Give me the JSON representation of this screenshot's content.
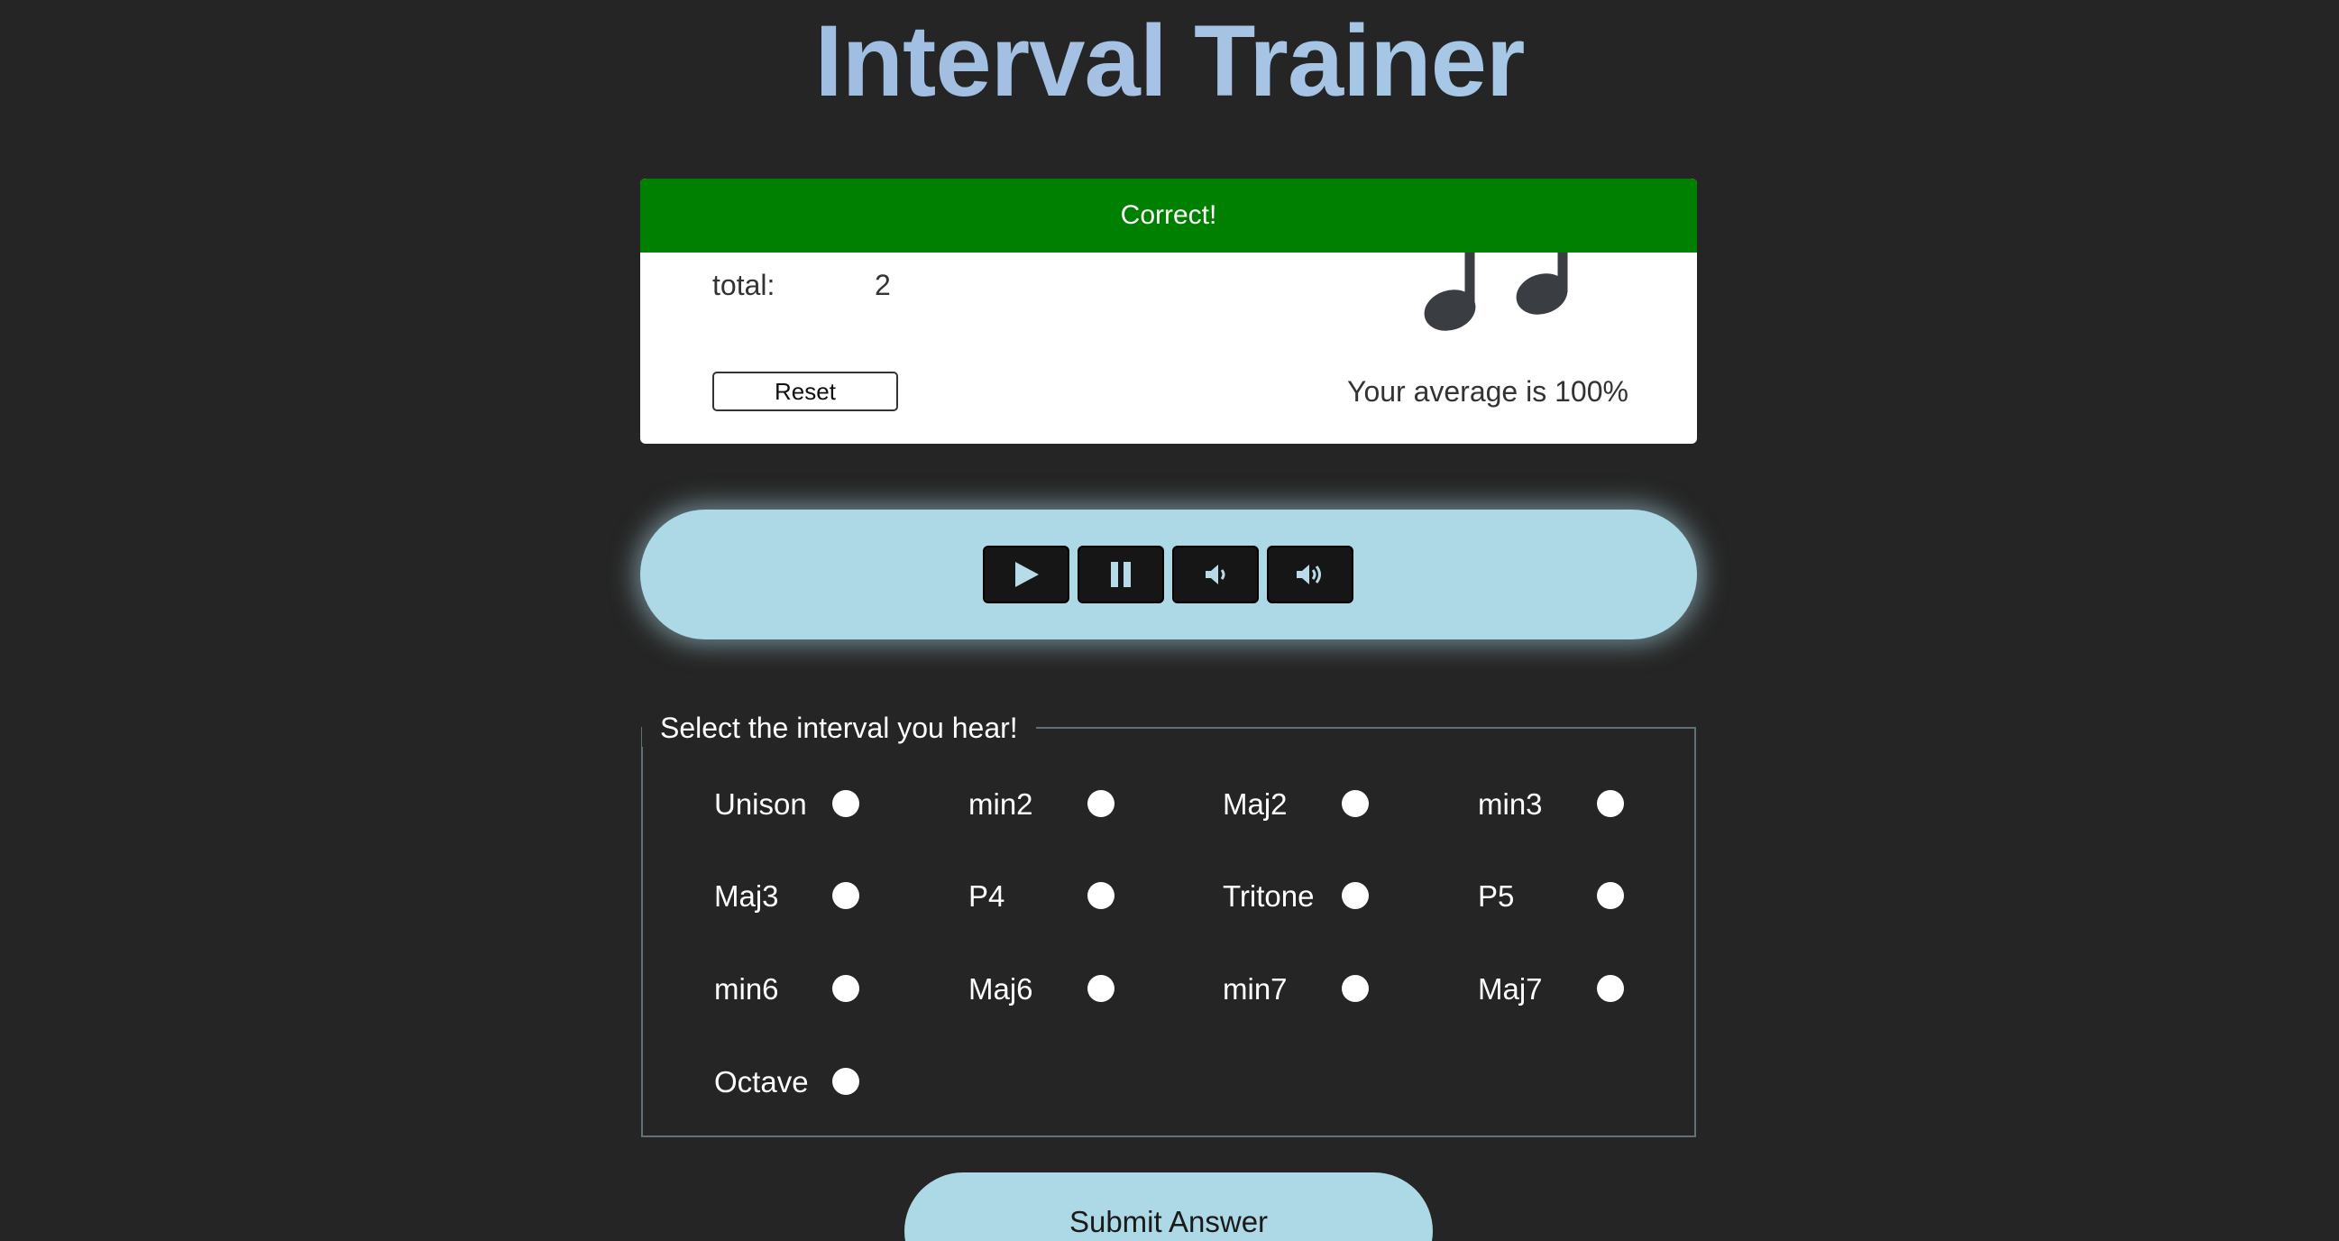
{
  "app": {
    "title": "Interval Trainer"
  },
  "score": {
    "feedback": "Correct!",
    "total_label": "total:",
    "total_value": "2",
    "reset_label": "Reset",
    "average_text": "Your average is 100%"
  },
  "player": {
    "buttons": [
      {
        "name": "play",
        "icon": "play-icon"
      },
      {
        "name": "pause",
        "icon": "pause-icon"
      },
      {
        "name": "volume-down",
        "icon": "volume-low-icon"
      },
      {
        "name": "volume-up",
        "icon": "volume-high-icon"
      }
    ]
  },
  "intervals": {
    "legend": "Select the interval you hear!",
    "options": [
      "Unison",
      "min2",
      "Maj2",
      "min3",
      "Maj3",
      "P4",
      "Tritone",
      "P5",
      "min6",
      "Maj6",
      "min7",
      "Maj7",
      "Octave"
    ]
  },
  "submit_label": "Submit Answer",
  "colors": {
    "background": "#252525",
    "accent": "#add8e6",
    "success": "#008000",
    "title_gradient_start": "#8fb3da",
    "title_gradient_end": "#a8d8ea"
  }
}
